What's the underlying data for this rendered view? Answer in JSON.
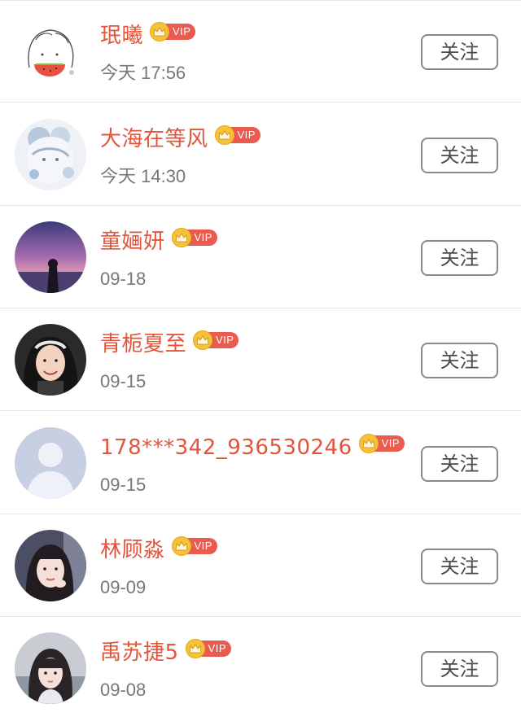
{
  "users": [
    {
      "name": "珉曦",
      "vip_label": "VIP",
      "time": "今天 17:56",
      "follow_label": "关注",
      "avatar": "cartoon-watermelon-girl-avatar"
    },
    {
      "name": "大海在等风",
      "vip_label": "VIP",
      "time": "今天 14:30",
      "follow_label": "关注",
      "avatar": "anime-pastel-girl-avatar"
    },
    {
      "name": "童婳妍",
      "vip_label": "VIP",
      "time": "09-18",
      "follow_label": "关注",
      "avatar": "sunset-silhouette-avatar"
    },
    {
      "name": "青栀夏至",
      "vip_label": "VIP",
      "time": "09-15",
      "follow_label": "关注",
      "avatar": "smiling-girl-headband-avatar"
    },
    {
      "name": "178***342_936530246",
      "vip_label": "VIP",
      "time": "09-15",
      "follow_label": "关注",
      "avatar": "default-person-avatar"
    },
    {
      "name": "林顾淼",
      "vip_label": "VIP",
      "time": "09-09",
      "follow_label": "关注",
      "avatar": "girl-hand-on-cheek-avatar"
    },
    {
      "name": "禹苏捷5",
      "vip_label": "VIP",
      "time": "09-08",
      "follow_label": "关注",
      "avatar": "girl-long-hair-seaside-avatar"
    }
  ],
  "colors": {
    "name": "#e2553b",
    "vip_badge": "#e85b4e",
    "crown": "#f6c23a",
    "time": "#777777",
    "button_border": "#8a8a8a",
    "divider": "#e6e6e6"
  }
}
